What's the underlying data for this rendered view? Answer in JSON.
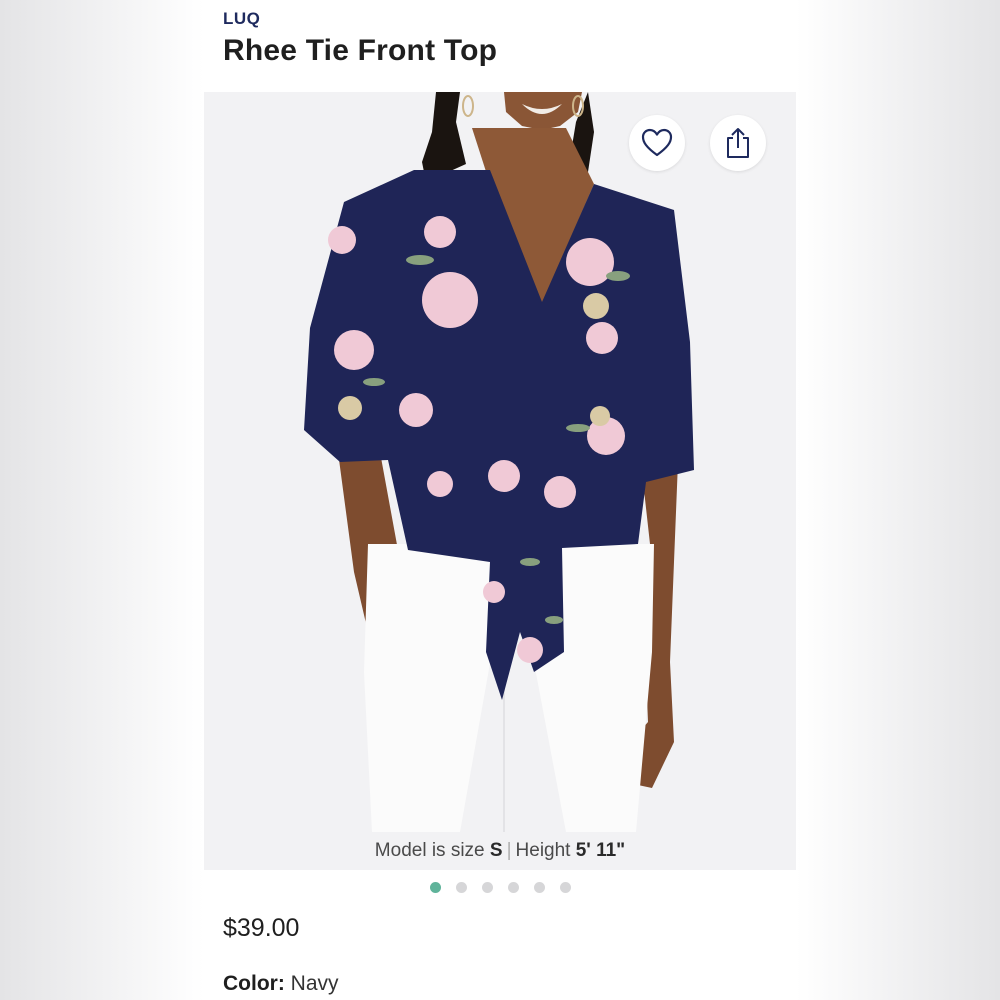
{
  "product": {
    "brand": "LUQ",
    "title": "Rhee Tie Front Top",
    "price": "$39.00",
    "color_label": "Color:",
    "color_value": "Navy"
  },
  "gallery": {
    "image_description": "Model wearing navy floral short-sleeve tie-front top with white jeans",
    "caption": {
      "size_text": "Model is size",
      "size_value": "S",
      "separator": "|",
      "height_text": "Height",
      "height_value": "5' 11\""
    },
    "total_images": 6,
    "active_index": 0
  },
  "actions": {
    "favorite_icon": "heart-outline-icon",
    "share_icon": "share-upload-icon"
  },
  "colors": {
    "brand": "#1e2a5e",
    "accent_dot": "#5fb39a",
    "top_navy": "#1f2557",
    "jeans": "#fbfbfb"
  }
}
